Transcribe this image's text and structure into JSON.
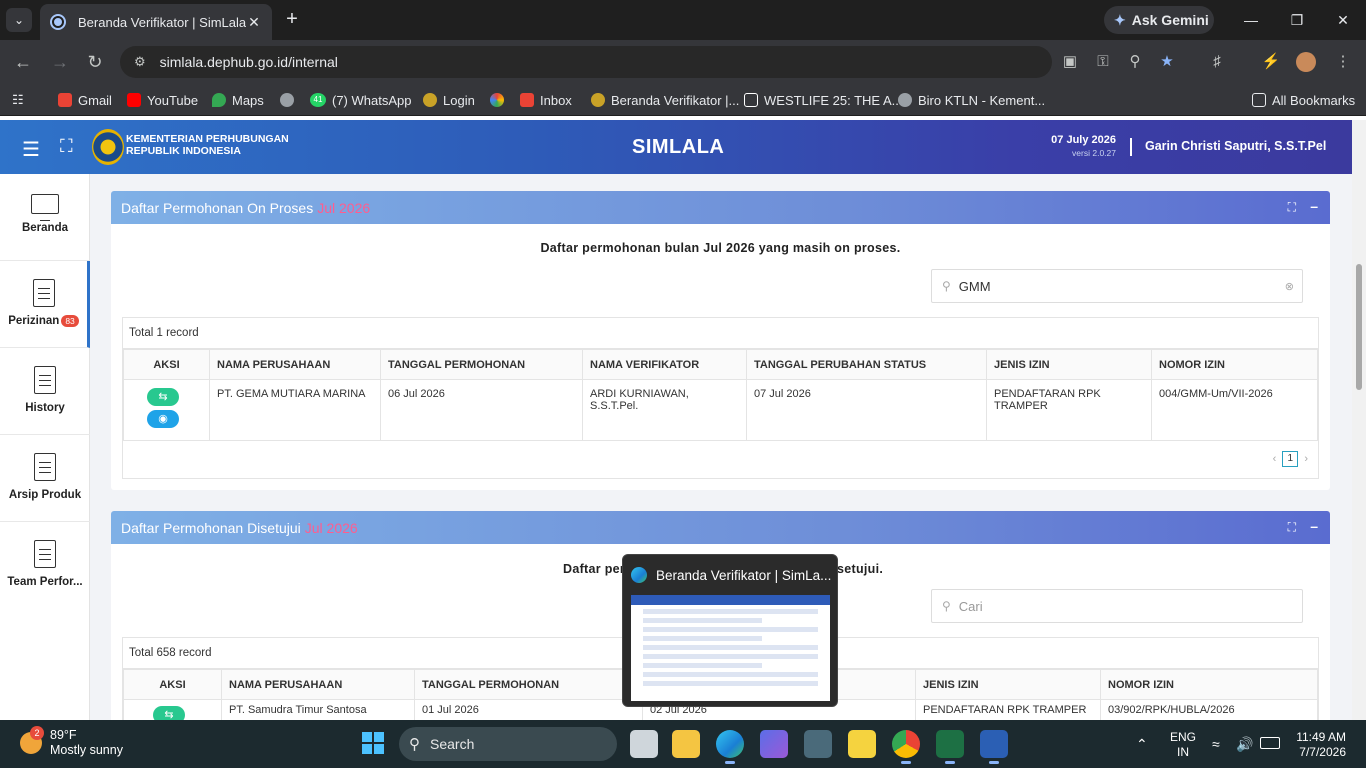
{
  "browser": {
    "tab_title": "Beranda Verifikator | SimLala",
    "ask_gemini": "Ask Gemini",
    "url": "simlala.dephub.go.id/internal",
    "bookmarks": [
      {
        "label": "Gmail",
        "color": "#ea4335"
      },
      {
        "label": "YouTube",
        "color": "#ff0000"
      },
      {
        "label": "Maps",
        "color": "#34a853"
      },
      {
        "label": "",
        "color": "#9aa0a6"
      },
      {
        "label": "(7) WhatsApp",
        "color": "#25d366"
      },
      {
        "label": "Login",
        "color": "#c9a227"
      },
      {
        "label": "",
        "color": "#fbbc04"
      },
      {
        "label": "Inbox",
        "color": "#ea4335"
      },
      {
        "label": "Beranda Verifikator |...",
        "color": "#c9a227"
      },
      {
        "label": "WESTLIFE 25: THE A...",
        "color": "#ffffff"
      },
      {
        "label": "Biro KTLN - Kement...",
        "color": "#9aa0a6"
      }
    ],
    "whatsapp_count": "41",
    "all_bookmarks": "All Bookmarks"
  },
  "app": {
    "ministry_line1": "KEMENTERIAN PERHUBUNGAN",
    "ministry_line2": "REPUBLIK INDONESIA",
    "title": "SIMLALA",
    "date": "07 July 2026",
    "version": "versi 2.0.27",
    "user": "Garin Christi Saputri, S.S.T.Pel"
  },
  "sidebar": {
    "items": [
      {
        "label": "Beranda"
      },
      {
        "label": "Perizinan",
        "badge": "83"
      },
      {
        "label": "History"
      },
      {
        "label": "Arsip Produk"
      },
      {
        "label": "Team Perfor..."
      }
    ]
  },
  "card1": {
    "title": "Daftar Permohonan On Proses",
    "month": "Jul 2026",
    "description": "Daftar permohonan bulan Jul 2026 yang masih on proses.",
    "search_value": "GMM",
    "total": "Total 1 record",
    "columns": [
      "AKSI",
      "NAMA PERUSAHAAN",
      "TANGGAL PERMOHONAN",
      "NAMA VERIFIKATOR",
      "TANGGAL PERUBAHAN STATUS",
      "JENIS IZIN",
      "NOMOR IZIN"
    ],
    "rows": [
      {
        "company": "PT. GEMA MUTIARA MARINA",
        "request_date": "06 Jul 2026",
        "verifier": "ARDI KURNIAWAN, S.S.T.Pel.",
        "status_date": "07 Jul 2026",
        "permit_type": "PENDAFTARAN RPK TRAMPER",
        "permit_no": "004/GMM-Um/VII-2026"
      }
    ],
    "page": "1"
  },
  "card2": {
    "title": "Daftar Permohonan Disetujui",
    "month": "Jul 2026",
    "description_left": "Daftar per",
    "description_right": "setujui.",
    "search_placeholder": "Cari",
    "total": "Total 658 record",
    "columns": [
      "AKSI",
      "NAMA PERUSAHAAN",
      "TANGGAL PERMOHONAN",
      "",
      "JENIS IZIN",
      "NOMOR IZIN"
    ],
    "rows": [
      {
        "company": "PT. Samudra Timur Santosa",
        "request_date": "01 Jul 2026",
        "status_date": "02 Jul 2026",
        "permit_type": "PENDAFTARAN RPK TRAMPER",
        "permit_no": "03/902/RPK/HUBLA/2026"
      }
    ]
  },
  "popup": {
    "title": "Beranda Verifikator | SimLa..."
  },
  "taskbar": {
    "weather_badge": "2",
    "temp": "89°F",
    "weather": "Mostly sunny",
    "search": "Search",
    "lang1": "ENG",
    "lang2": "IN",
    "time": "11:49 AM",
    "date": "7/7/2026"
  }
}
